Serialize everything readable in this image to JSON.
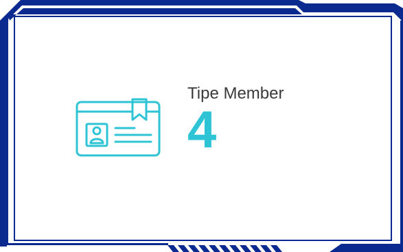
{
  "card": {
    "label": "Tipe Member",
    "value": "4",
    "icon": "id-card-icon"
  },
  "colors": {
    "frame": "#0b2a8f",
    "accent": "#2ec4d6",
    "label_text": "#3a3a3a",
    "background": "#ffffff"
  }
}
